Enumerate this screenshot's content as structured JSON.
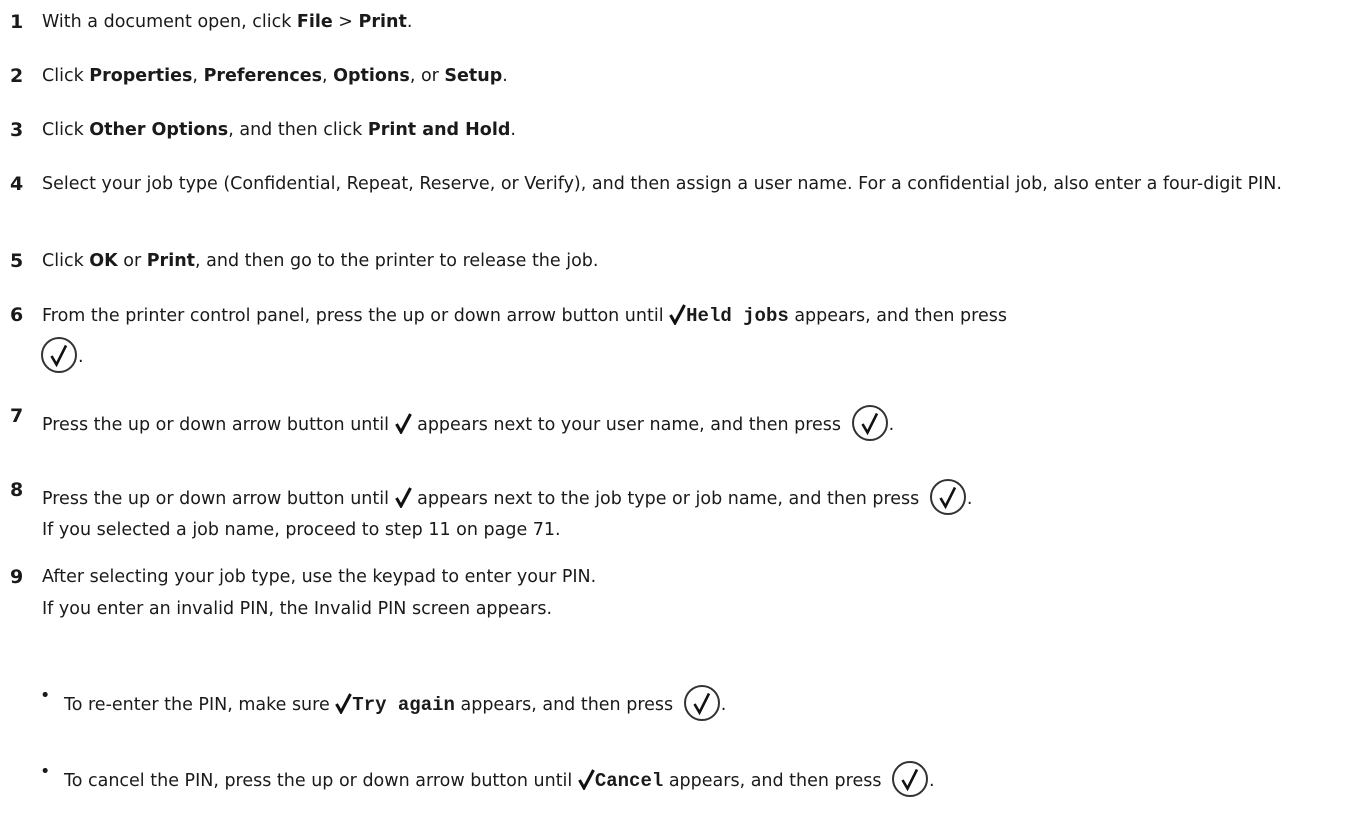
{
  "steps": [
    {
      "number": "1",
      "t1": "With a document open, click ",
      "b1": "File",
      "t2": " > ",
      "b2": "Print",
      "t3": "."
    },
    {
      "number": "2",
      "t1": "Click ",
      "b1": "Properties",
      "t2": ", ",
      "b2": "Preferences",
      "t3": ", ",
      "b3": "Options",
      "t4": ", or ",
      "b4": "Setup",
      "t5": "."
    },
    {
      "number": "3",
      "t1": "Click ",
      "b1": "Other Options",
      "t2": ", and then click ",
      "b2": "Print and Hold",
      "t3": "."
    },
    {
      "number": "4",
      "text": "Select your job type (Confidential, Repeat, Reserve, or Verify), and then assign a user name. For a confidential job, also enter a four-digit PIN."
    },
    {
      "number": "5",
      "t1": "Click ",
      "b1": "OK",
      "t2": " or ",
      "b2": "Print",
      "t3": ", and then go to the printer to release the job."
    },
    {
      "number": "6",
      "t1": "From the printer control panel, press the up or down arrow button until ",
      "code": "Held jobs",
      "t2": " appears, and then press",
      "t3": "."
    },
    {
      "number": "7",
      "t1": "Press the up or down arrow button until ",
      "t2": " appears next to your user name, and then press ",
      "t3": "."
    },
    {
      "number": "8",
      "t1": "Press the up or down arrow button until ",
      "t2": " appears next to the job type or job name, and then press ",
      "t3": ".",
      "note": "If you selected a job name, proceed to step 11 on page 71."
    },
    {
      "number": "9",
      "text": "After selecting your job type, use the keypad to enter your PIN.",
      "note": "If you enter an invalid PIN, the Invalid PIN screen appears."
    }
  ],
  "bullets": [
    {
      "t1": "To re-enter the PIN, make sure ",
      "code": "Try again",
      "t2": " appears, and then press ",
      "t3": "."
    },
    {
      "t1": "To cancel the PIN, press the up or down arrow button until ",
      "code": "Cancel",
      "t2": " appears, and then press ",
      "t3": "."
    }
  ],
  "bullet_glyph": "•",
  "icons": {
    "check": "checkmark-icon",
    "select_button": "select-button-icon"
  }
}
